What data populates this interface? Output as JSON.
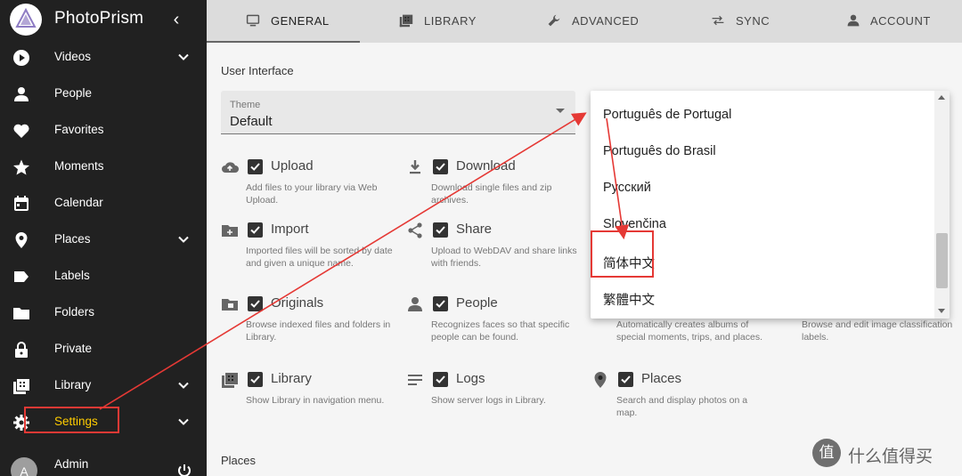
{
  "app": {
    "title": "PhotoPrism"
  },
  "sidebar": {
    "items": [
      {
        "label": "Videos",
        "icon": "play-circle-icon",
        "chevron": true
      },
      {
        "label": "People",
        "icon": "person-icon",
        "chevron": false
      },
      {
        "label": "Favorites",
        "icon": "heart-icon",
        "chevron": false
      },
      {
        "label": "Moments",
        "icon": "star-icon",
        "chevron": false
      },
      {
        "label": "Calendar",
        "icon": "calendar-icon",
        "chevron": false
      },
      {
        "label": "Places",
        "icon": "map-marker-icon",
        "chevron": true
      },
      {
        "label": "Labels",
        "icon": "label-icon",
        "chevron": false
      },
      {
        "label": "Folders",
        "icon": "folder-icon",
        "chevron": false
      },
      {
        "label": "Private",
        "icon": "lock-icon",
        "chevron": false
      },
      {
        "label": "Library",
        "icon": "library-icon",
        "chevron": true
      },
      {
        "label": "Settings",
        "icon": "gear-icon",
        "chevron": true
      }
    ],
    "admin": {
      "label": "Admin",
      "avatar": "A"
    }
  },
  "tabs": [
    {
      "label": "GENERAL",
      "icon": "monitor-icon",
      "active": true
    },
    {
      "label": "LIBRARY",
      "icon": "library-icon",
      "active": false
    },
    {
      "label": "ADVANCED",
      "icon": "wrench-icon",
      "active": false
    },
    {
      "label": "SYNC",
      "icon": "sync-arrows-icon",
      "active": false
    },
    {
      "label": "ACCOUNT",
      "icon": "person-icon",
      "active": false
    }
  ],
  "ui": {
    "section_title": "User Interface",
    "theme": {
      "label": "Theme",
      "value": "Default"
    }
  },
  "features": [
    {
      "title": "Upload",
      "desc": "Add files to your library via Web Upload.",
      "icon": "cloud-upload-icon"
    },
    {
      "title": "Download",
      "desc": "Download single files and zip archives.",
      "icon": "download-icon"
    },
    {
      "title": "Import",
      "desc": "Imported files will be sorted by date and given a unique name.",
      "icon": "folder-plus-icon"
    },
    {
      "title": "Share",
      "desc": "Upload to WebDAV and share links with friends.",
      "icon": "share-icon"
    },
    {
      "title": "Originals",
      "desc": "Browse indexed files and folders in Library.",
      "icon": "folder-image-icon"
    },
    {
      "title": "People",
      "desc": "Recognizes faces so that specific people can be found.",
      "icon": "person-icon"
    },
    {
      "title": "",
      "desc": "Automatically creates albums of special moments, trips, and places.",
      "icon": ""
    },
    {
      "title": "",
      "desc": "Browse and edit image classification labels.",
      "icon": ""
    },
    {
      "title": "Library",
      "desc": "Show Library in navigation menu.",
      "icon": "library-icon"
    },
    {
      "title": "Logs",
      "desc": "Show server logs in Library.",
      "icon": "logs-icon"
    },
    {
      "title": "Places",
      "desc": "Search and display photos on a map.",
      "icon": "map-marker-icon"
    }
  ],
  "places_section": {
    "title": "Places"
  },
  "language_dropdown": {
    "options": [
      "Português de Portugal",
      "Português do Brasil",
      "Русский",
      "Slovenčina",
      "简体中文",
      "繁體中文"
    ],
    "highlighted": "简体中文"
  },
  "watermark": {
    "logo": "值",
    "text": "什么值得买"
  },
  "colors": {
    "sidebar_bg": "#212121",
    "annotation": "#e53935",
    "settings_text": "#ffcc00"
  }
}
